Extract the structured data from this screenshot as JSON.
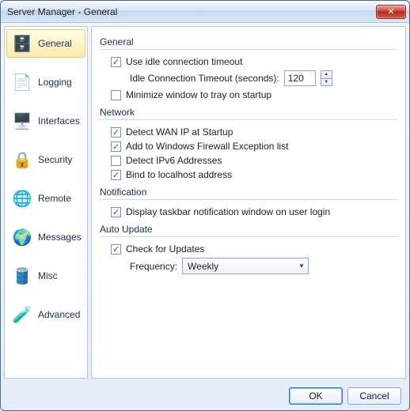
{
  "window": {
    "title": "Server Manager - General"
  },
  "sidebar": {
    "items": [
      {
        "label": "General",
        "icon": "🗄️",
        "selected": true
      },
      {
        "label": "Logging",
        "icon": "📄",
        "selected": false
      },
      {
        "label": "Interfaces",
        "icon": "🖥️",
        "selected": false
      },
      {
        "label": "Security",
        "icon": "🔒",
        "selected": false
      },
      {
        "label": "Remote",
        "icon": "🌐",
        "selected": false
      },
      {
        "label": "Messages",
        "icon": "🌍",
        "selected": false
      },
      {
        "label": "Misc",
        "icon": "🛢️",
        "selected": false
      },
      {
        "label": "Advanced",
        "icon": "🧪",
        "selected": false
      }
    ]
  },
  "groups": {
    "general": {
      "title": "General",
      "useIdle": {
        "label": "Use idle connection timeout",
        "checked": true
      },
      "idleLabel": "Idle Connection Timeout (seconds):",
      "idleValue": "120",
      "minimize": {
        "label": "Minimize window to tray on startup",
        "checked": false
      }
    },
    "network": {
      "title": "Network",
      "wan": {
        "label": "Detect WAN IP at Startup",
        "checked": true
      },
      "firewall": {
        "label": "Add to Windows Firewall Exception list",
        "checked": true
      },
      "ipv6": {
        "label": "Detect IPv6 Addresses",
        "checked": false
      },
      "localhost": {
        "label": "Bind to localhost address",
        "checked": true
      }
    },
    "notification": {
      "title": "Notification",
      "taskbar": {
        "label": "Display taskbar notification window on user login",
        "checked": true
      }
    },
    "autoUpdate": {
      "title": "Auto Update",
      "check": {
        "label": "Check for Updates",
        "checked": true
      },
      "freqLabel": "Frequency:",
      "freqValue": "Weekly"
    }
  },
  "footer": {
    "ok": "OK",
    "cancel": "Cancel"
  }
}
